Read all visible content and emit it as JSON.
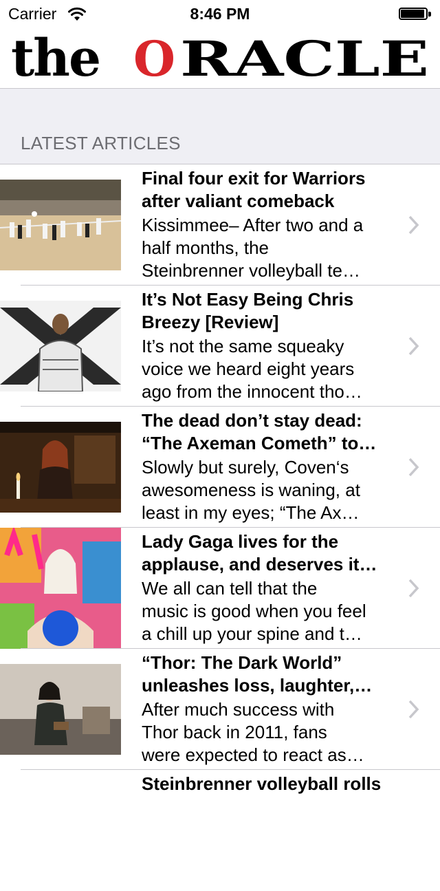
{
  "status_bar": {
    "carrier": "Carrier",
    "time": "8:46 PM"
  },
  "masthead": {
    "logo_text_the": "the",
    "logo_text_o": "O",
    "logo_text_rest": "RACLE",
    "accent_color": "#d9262b"
  },
  "section": {
    "header": "LATEST ARTICLES"
  },
  "articles": [
    {
      "title_line1": "Final four exit for Warriors",
      "title_line2": "after valiant comeback",
      "summary_line1": "Kissimmee– After two and a",
      "summary_line2": "half months, the",
      "summary_line3": "Steinbrenner volleyball te…",
      "thumbnail": "volleyball-game-photo"
    },
    {
      "title_line1": "It’s Not Easy Being Chris",
      "title_line2": "Breezy [Review]",
      "summary_line1": "It’s not the same squeaky",
      "summary_line2": "voice we heard eight years",
      "summary_line3": "ago from the innocent tho…",
      "thumbnail": "album-cover-x-straitjacket"
    },
    {
      "title_line1": "The dead don’t stay dead:",
      "title_line2": "“The Axeman Cometh” to…",
      "summary_line1": "Slowly but surely, Coven‘s",
      "summary_line2": "awesomeness is waning, at",
      "summary_line3": "least in my eyes; “The Ax…",
      "thumbnail": "tv-still-woman-candles"
    },
    {
      "title_line1": "Lady Gaga lives for the",
      "title_line2": "applause, and deserves it…",
      "summary_line1": "We all can tell that the",
      "summary_line2": "music is good when you feel",
      "summary_line3": "a chill up your spine and t…",
      "thumbnail": "artpop-album-cover"
    },
    {
      "title_line1": "“Thor: The Dark World”",
      "title_line2": "unleashes loss, laughter,…",
      "summary_line1": "After much success with",
      "summary_line2": "Thor back in 2011, fans",
      "summary_line3": "were expected to react as…",
      "thumbnail": "movie-still-man-reading"
    },
    {
      "title_line1": "Steinbrenner volleyball rolls",
      "title_line2": "",
      "summary_line1": "",
      "summary_line2": "",
      "summary_line3": "",
      "thumbnail": ""
    }
  ]
}
